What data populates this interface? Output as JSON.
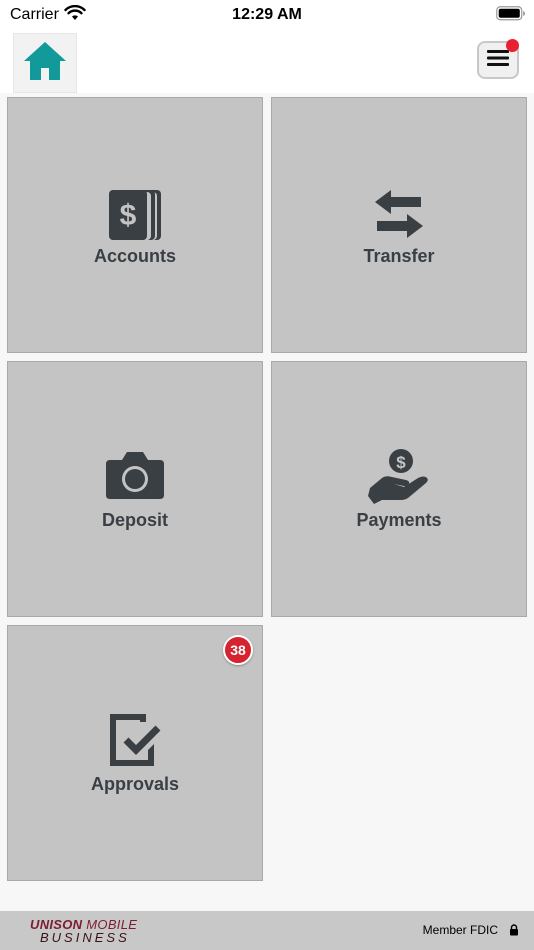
{
  "status_bar": {
    "carrier": "Carrier",
    "time": "12:29 AM"
  },
  "header": {
    "home_icon": "home-icon",
    "menu_icon": "hamburger-menu-icon",
    "notification_dot": true
  },
  "tiles": [
    {
      "label": "Accounts",
      "icon": "dollar-stack-icon"
    },
    {
      "label": "Transfer",
      "icon": "swap-arrows-icon"
    },
    {
      "label": "Deposit",
      "icon": "camera-icon"
    },
    {
      "label": "Payments",
      "icon": "hand-coin-icon"
    },
    {
      "label": "Approvals",
      "icon": "approval-check-icon",
      "badge": "38"
    }
  ],
  "footer": {
    "brand_top_bold": "UNISON",
    "brand_top_light": "MOBILE",
    "brand_bottom": "BUSINESS",
    "member_text": "Member FDIC"
  },
  "colors": {
    "tile_bg": "#c4c4c4",
    "tile_icon": "#3a3f44",
    "home_icon": "#129a9a",
    "badge": "#d5232f",
    "brand": "#7d1c2f",
    "footer_bg": "#c8c8c8"
  }
}
